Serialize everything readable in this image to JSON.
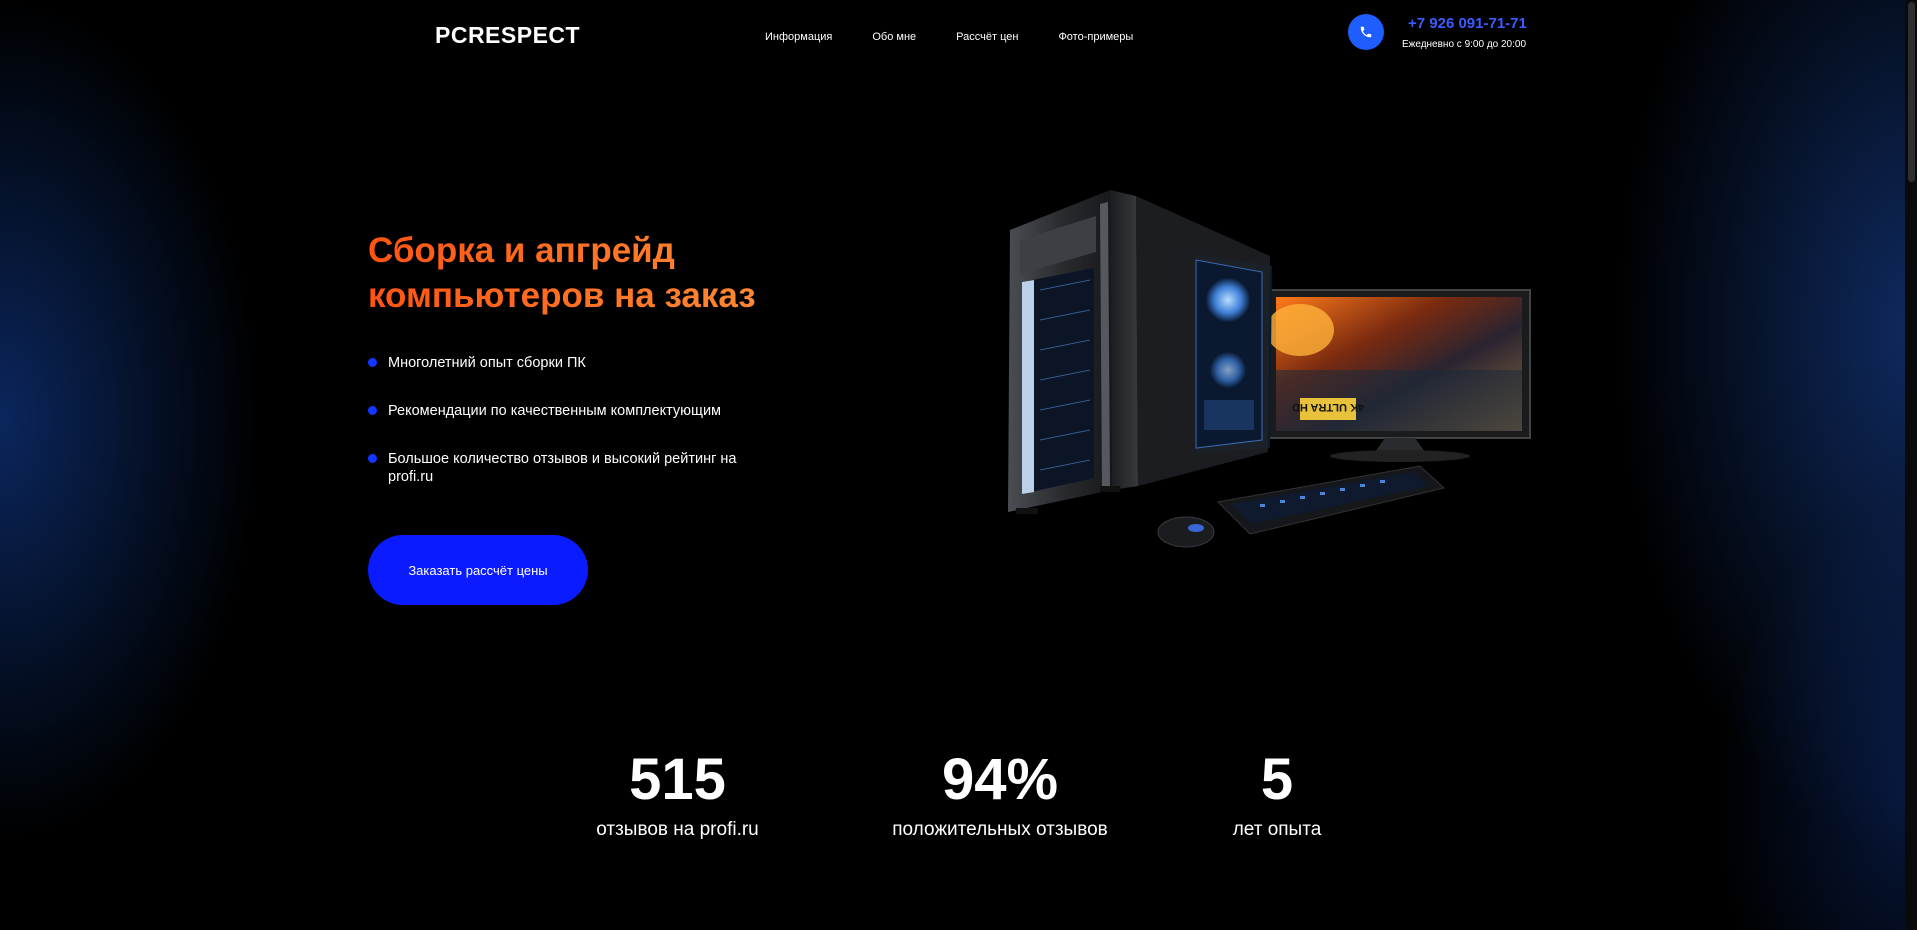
{
  "header": {
    "logo": "PCRESPECT",
    "nav": [
      {
        "label": "Информация"
      },
      {
        "label": "Обо мне"
      },
      {
        "label": "Рассчёт цен"
      },
      {
        "label": "Фото-примеры"
      }
    ],
    "phone": "+7 926 091-71-71",
    "hours": "Ежедневно с 9:00 до 20:00"
  },
  "hero": {
    "title_line1": "Сборка и апгрейд",
    "title_line2": "компьютеров на заказ",
    "features": [
      {
        "text": "Многолетний опыт сборки ПК"
      },
      {
        "text": "Рекомендации по качественным комплектующим"
      },
      {
        "text": "Большое количество отзывов и высокий рейтинг на profi.ru"
      }
    ],
    "cta_label": "Заказать рассчёт цены",
    "screen_badge": "4K ULTRA HD"
  },
  "stats": [
    {
      "value": "515",
      "label": "отзывов на profi.ru"
    },
    {
      "value": "94%",
      "label": "положительных отзывов"
    },
    {
      "value": "5",
      "label": "лет опыта"
    }
  ],
  "colors": {
    "accent_blue": "#0a1cff",
    "phone_blue": "#3d5cff",
    "title_orange": "#ff5412",
    "title_orange_light": "#ff9a3e"
  },
  "icons": {
    "phone": "phone-icon"
  }
}
